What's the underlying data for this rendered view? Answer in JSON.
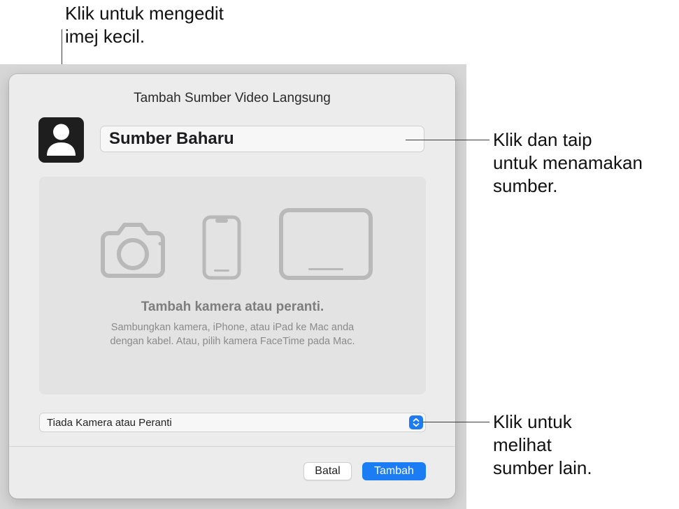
{
  "callouts": {
    "thumbnail": {
      "line1": "Klik untuk mengedit",
      "line2": "imej kecil."
    },
    "name": {
      "line1": "Klik dan taip",
      "line2": "untuk menamakan",
      "line3": "sumber."
    },
    "sources": {
      "line1": "Klik untuk",
      "line2": "melihat",
      "line3": "sumber lain."
    }
  },
  "dialog": {
    "title": "Tambah Sumber Video Langsung",
    "thumbnail_icon": "person-icon",
    "name_value": "Sumber Baharu",
    "drop_area": {
      "icons": [
        "camera-icon",
        "iphone-icon",
        "ipad-icon"
      ],
      "title": "Tambah kamera atau peranti.",
      "description_line1": "Sambungkan kamera, iPhone, atau iPad ke Mac anda",
      "description_line2": "dengan kabel. Atau, pilih kamera FaceTime pada Mac."
    },
    "source_select": {
      "value": "Tiada Kamera atau Peranti",
      "icon": "up-down-chevron-icon"
    },
    "buttons": {
      "cancel": "Batal",
      "add": "Tambah"
    },
    "colors": {
      "accent": "#1b7cf4",
      "thumbnail_bg": "#1e1e1e"
    }
  }
}
